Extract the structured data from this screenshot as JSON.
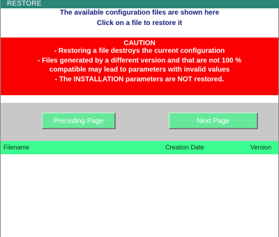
{
  "window": {
    "title": "RESTORE"
  },
  "info": {
    "line1": "The available configuration files are shown here",
    "line2": "Click on a file to restore it"
  },
  "caution": {
    "heading": "CAUTION",
    "lines": [
      "- Restoring a file destroys the current configuration",
      "- Files generated by a different version and that are not 100 %",
      "compatible may lead to parameters with invalid values",
      "- The INSTALLATION parameters are NOT restored."
    ]
  },
  "navigation": {
    "prev_label": "Preceding Page",
    "next_label": "Next Page"
  },
  "table": {
    "columns": [
      "Filename",
      "Creation Date",
      "Version"
    ],
    "rows": []
  },
  "colors": {
    "title_bar": "#2a8577",
    "caution_bg": "#fb0000",
    "info_text": "#0e1b7a",
    "button_bg": "#66e89b",
    "header_bg": "#3afc8f",
    "nav_panel_bg": "#c8c8c8"
  }
}
